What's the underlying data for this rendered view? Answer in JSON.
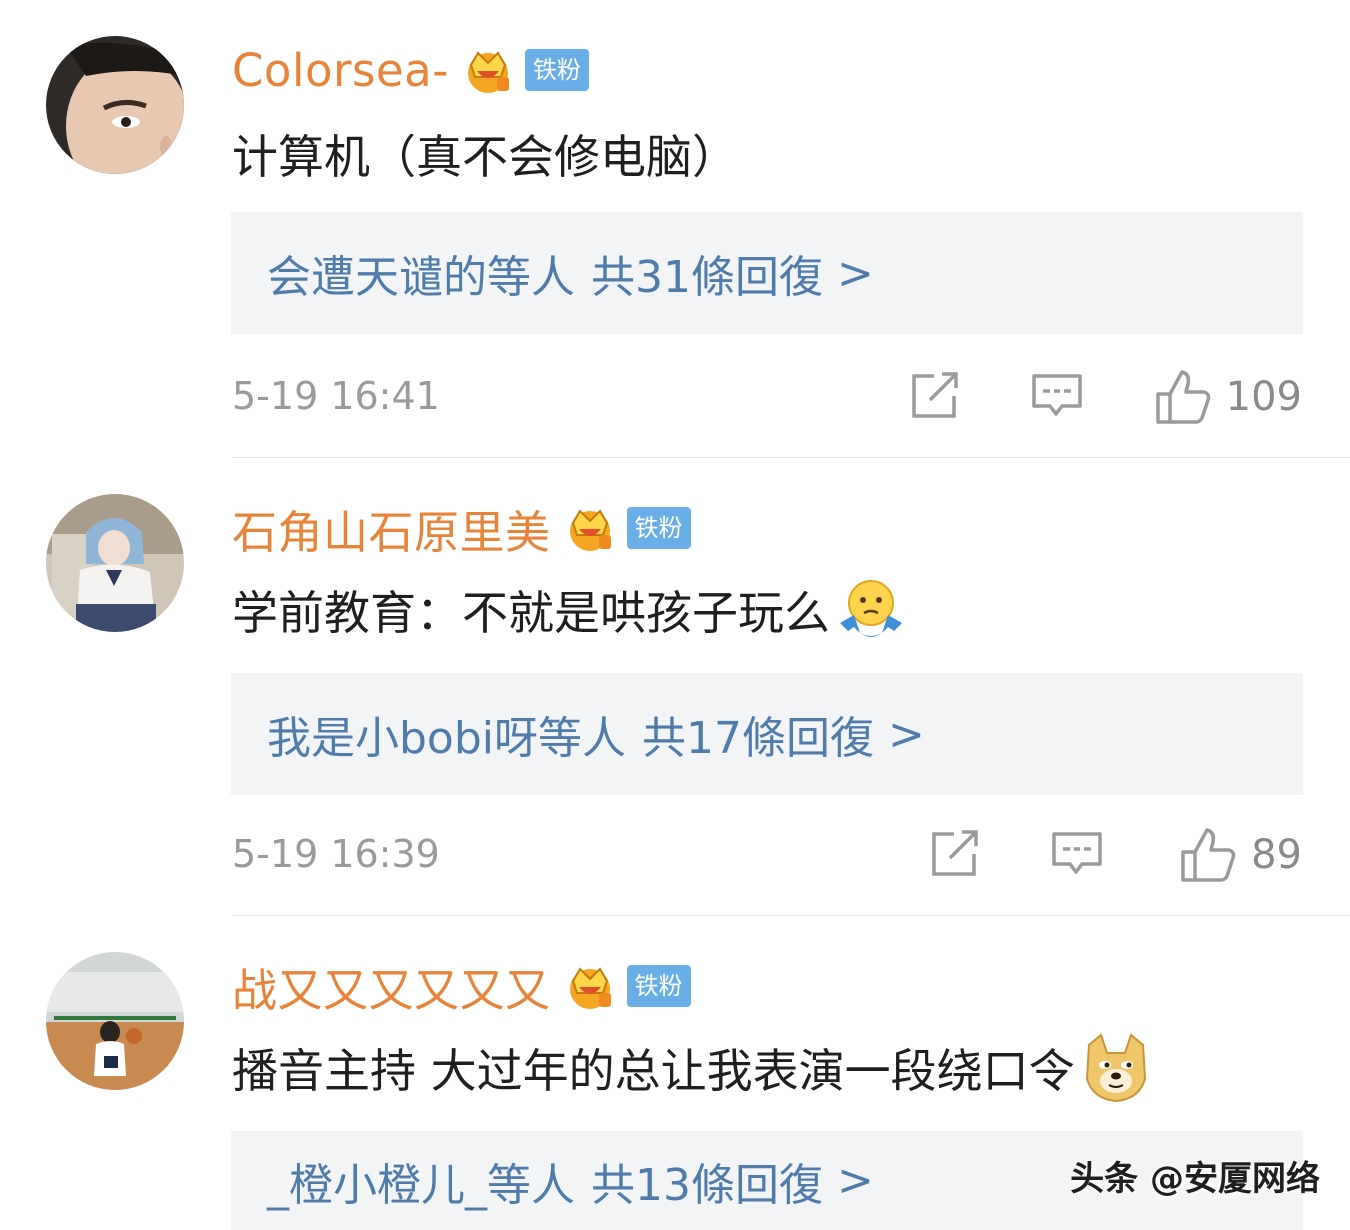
{
  "comments": [
    {
      "username": "Colorsea-",
      "badge": "铁粉",
      "text": "计算机（真不会修电脑）",
      "replies_users": "会遭天谴的等人",
      "replies_count": "共31條回復",
      "chevron": ">",
      "timestamp": "5-19 16:41",
      "likes": "109",
      "avatar": "man-face-closeup",
      "emoji": ""
    },
    {
      "username": "石角山石原里美",
      "badge": "铁粉",
      "text": "学前教育：不就是哄孩子玩么",
      "replies_users": "我是小bobi呀等人",
      "replies_count": "共17條回復",
      "chevron": ">",
      "timestamp": "5-19 16:39",
      "likes": "89",
      "avatar": "cosplay-girl-blue-hair",
      "emoji": "shrug-emoji"
    },
    {
      "username": "战又又又又又又",
      "badge": "铁粉",
      "text": "播音主持 大过年的总让我表演一段绕口令",
      "replies_users": "_橙小橙儿_等人",
      "replies_count": "共13條回復",
      "chevron": ">",
      "timestamp": "",
      "likes": "",
      "avatar": "basketball-court-player",
      "emoji": "doge-emoji"
    }
  ],
  "watermark": "头条 @安厦网络",
  "colors": {
    "username": "#e8833a",
    "badge": "#6aaee8",
    "reply_link": "#4f7cab",
    "reply_bg": "#f3f4f6",
    "meta": "#9a9a9a"
  }
}
